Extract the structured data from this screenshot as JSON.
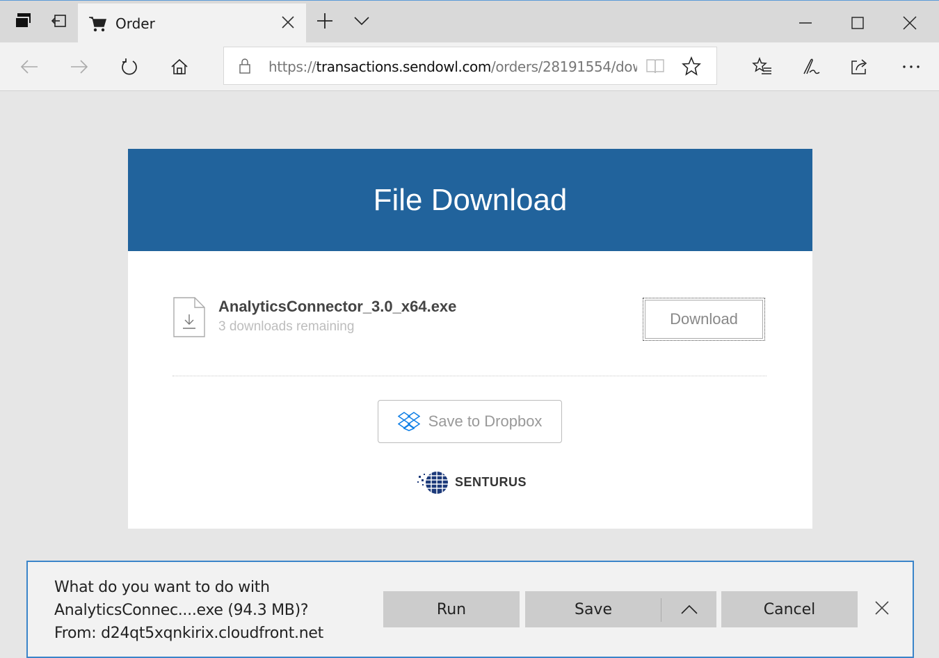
{
  "browser": {
    "tab": {
      "title": "Order"
    },
    "address": {
      "url_prefix": "https://",
      "url_domain": "transactions.sendowl.com",
      "url_path": "/orders/28191554/dow"
    }
  },
  "page": {
    "header_title": "File Download",
    "file": {
      "name": "AnalyticsConnector_3.0_x64.exe",
      "subtitle": "3 downloads remaining"
    },
    "download_button": "Download",
    "dropbox_button": "Save to Dropbox",
    "logo_text": "SENTURUS"
  },
  "download_bar": {
    "message_line1": "What do you want to do with",
    "message_line2": "AnalyticsConnec....exe (94.3 MB)?",
    "message_line3": "From: d24qt5xqnkirix.cloudfront.net",
    "run_label": "Run",
    "save_label": "Save",
    "cancel_label": "Cancel"
  },
  "colors": {
    "header_blue": "#21639c",
    "download_bar_border": "#3a84c9",
    "dropbox_blue": "#0d7ee6"
  }
}
